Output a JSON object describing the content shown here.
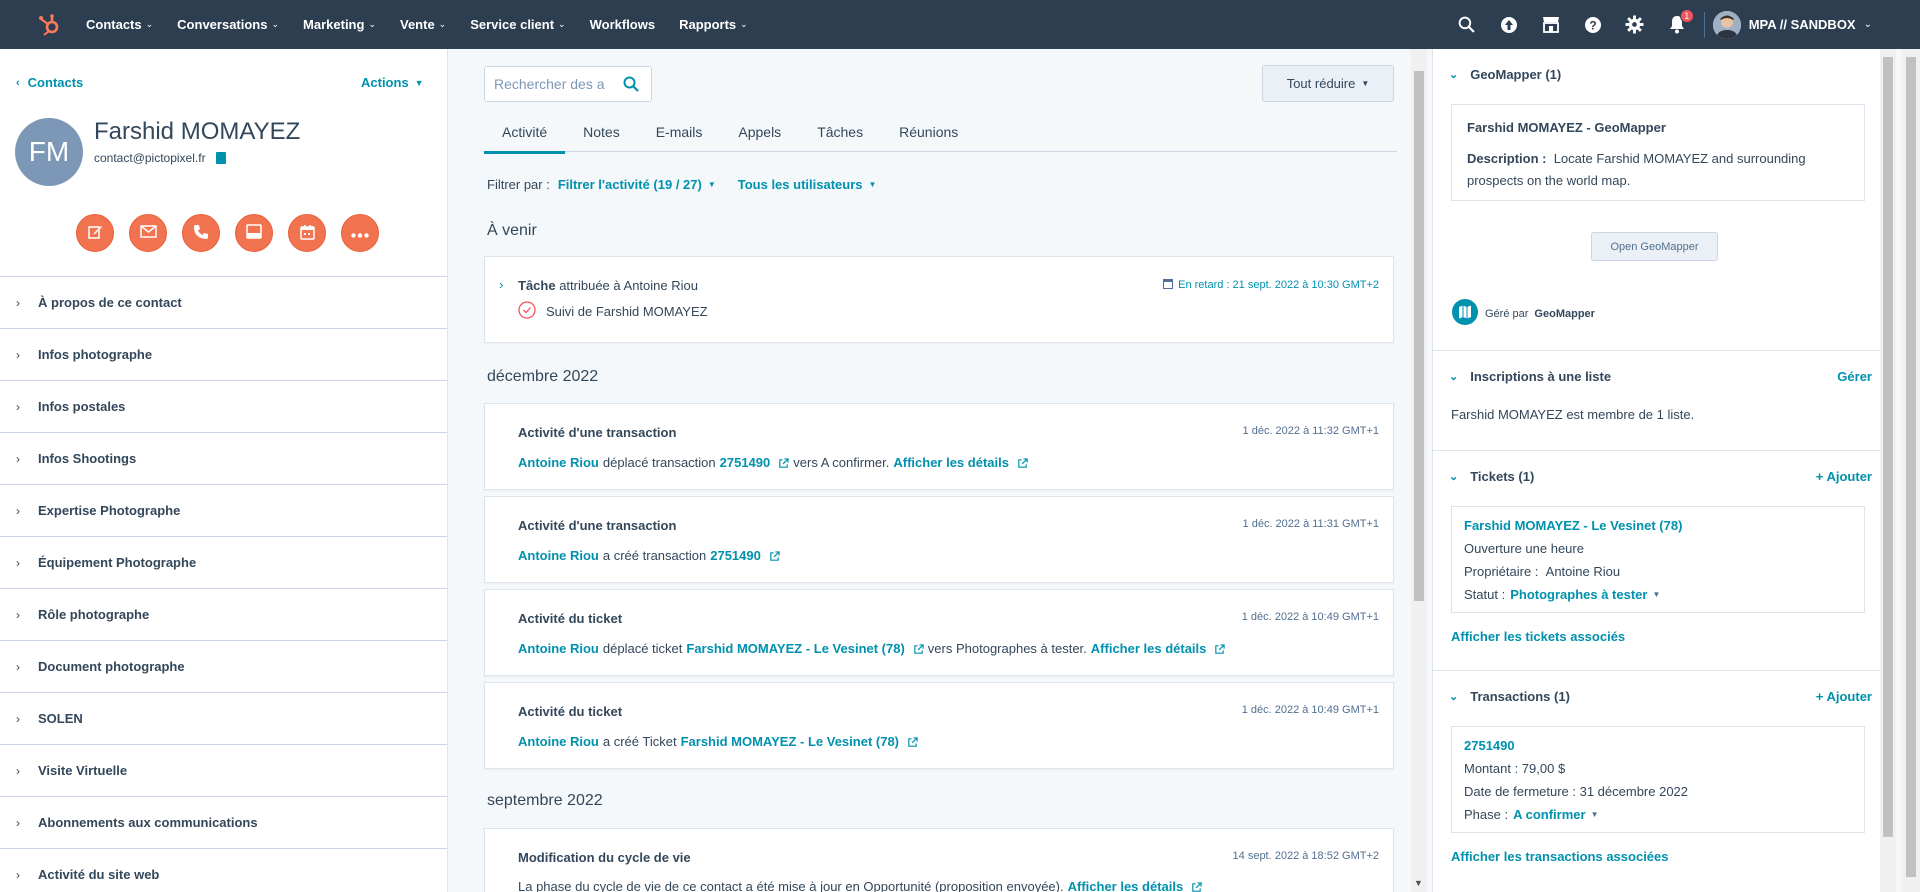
{
  "nav": {
    "items": [
      "Contacts",
      "Conversations",
      "Marketing",
      "Vente",
      "Service client",
      "Workflows",
      "Rapports"
    ],
    "has_chevron": [
      true,
      true,
      true,
      true,
      true,
      false,
      true
    ],
    "notification_count": "1",
    "account": "MPA // SANDBOX"
  },
  "left": {
    "back_label": "Contacts",
    "actions_label": "Actions",
    "avatar_initials": "FM",
    "name": "Farshid MOMAYEZ",
    "email": "contact@pictopixel.fr",
    "sections": [
      "À propos de ce contact",
      "Infos photographe",
      "Infos postales",
      "Infos Shootings",
      "Expertise Photographe",
      "Équipement Photographe",
      "Rôle photographe",
      "Document photographe",
      "SOLEN",
      "Visite Virtuelle",
      "Abonnements aux communications",
      "Activité du site web"
    ]
  },
  "middle": {
    "search_placeholder": "Rechercher des a",
    "collapse_label": "Tout réduire",
    "tabs": [
      "Activité",
      "Notes",
      "E-mails",
      "Appels",
      "Tâches",
      "Réunions"
    ],
    "filter_prefix": "Filtrer par :",
    "filter_activity": "Filtrer l'activité (19 / 27)",
    "filter_users": "Tous les utilisateurs",
    "upcoming_title": "À venir",
    "task": {
      "title_bold": "Tâche",
      "title_rest": " attribuée à Antoine Riou",
      "due": "En retard : 21 sept. 2022 à 10:30 GMT+2",
      "subject": "Suivi de Farshid MOMAYEZ"
    },
    "month1": "décembre 2022",
    "activities": [
      {
        "title": "Activité d'une transaction",
        "date": "1 déc. 2022 à 11:32 GMT+1",
        "user": "Antoine Riou",
        "text1": " déplacé transaction ",
        "object": "2751490",
        "text2": " vers A confirmer. ",
        "details": "Afficher les détails"
      },
      {
        "title": "Activité d'une transaction",
        "date": "1 déc. 2022 à 11:31 GMT+1",
        "user": "Antoine Riou",
        "text1": " a créé transaction ",
        "object": "2751490",
        "text2": "",
        "details": ""
      },
      {
        "title": "Activité du ticket",
        "date": "1 déc. 2022 à 10:49 GMT+1",
        "user": "Antoine Riou",
        "text1": " déplacé ticket ",
        "object": "Farshid MOMAYEZ - Le Vesinet (78)",
        "text2": " vers Photographes à tester. ",
        "details": "Afficher les détails"
      },
      {
        "title": "Activité du ticket",
        "date": "1 déc. 2022 à 10:49 GMT+1",
        "user": "Antoine Riou",
        "text1": " a créé Ticket ",
        "object": "Farshid MOMAYEZ - Le Vesinet (78)",
        "text2": "",
        "details": ""
      }
    ],
    "month2": "septembre 2022",
    "lifecycle": {
      "title": "Modification du cycle de vie",
      "date": "14 sept. 2022 à 18:52 GMT+2",
      "text": "La phase du cycle de vie de ce contact a été mise à jour en Opportunité (proposition envoyée). ",
      "details": "Afficher les détails"
    }
  },
  "right": {
    "geomapper": {
      "title": "GeoMapper (1)",
      "card_title": "Farshid MOMAYEZ - GeoMapper",
      "desc_label": "Description :",
      "desc": "Locate Farshid MOMAYEZ and surrounding prospects on the world map.",
      "button": "Open GeoMapper",
      "managed_prefix": "Géré par",
      "managed_by": "GeoMapper"
    },
    "lists": {
      "title": "Inscriptions à une liste",
      "manage": "Gérer",
      "text": "Farshid MOMAYEZ est membre de 1 liste."
    },
    "tickets": {
      "title": "Tickets (1)",
      "add": "+ Ajouter",
      "name": "Farshid MOMAYEZ - Le Vesinet (78)",
      "opened": "Ouverture une heure",
      "owner_label": "Propriétaire :",
      "owner": "Antoine Riou",
      "status_label": "Statut :",
      "status": "Photographes à tester",
      "view_all": "Afficher les tickets associés"
    },
    "deals": {
      "title": "Transactions (1)",
      "add": "+ Ajouter",
      "name": "2751490",
      "amount": "Montant : 79,00 $",
      "close_date": "Date de fermeture : 31 décembre 2022",
      "phase_label": "Phase :",
      "phase": "A confirmer",
      "view_all": "Afficher les transactions associées"
    }
  },
  "colors": {
    "nav_bg": "#2d3e50",
    "accent": "#0091ae",
    "action_orange": "#f2734f",
    "overdue_red": "#f2545b"
  }
}
